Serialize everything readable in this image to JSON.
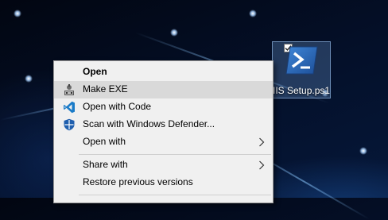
{
  "desktop": {
    "icon": {
      "label": "IIS Setup.ps1",
      "icon_name": "powershell-file-icon",
      "checked": true
    }
  },
  "context_menu": {
    "items": [
      {
        "label": "Open",
        "bold": true,
        "icon": null
      },
      {
        "label": "Make EXE",
        "icon": "make-exe-icon"
      },
      {
        "label": "Open with Code",
        "icon": "vscode-icon"
      },
      {
        "label": "Scan with Windows Defender...",
        "icon": "windows-defender-icon"
      },
      {
        "label": "Open with",
        "icon": null,
        "submenu": true
      },
      {
        "label": "Share with",
        "icon": null,
        "submenu": true
      },
      {
        "label": "Restore previous versions",
        "icon": null
      }
    ]
  },
  "colors": {
    "menu_background": "#f0f0f0",
    "menu_hover": "#d9d9d9",
    "vscode_blue": "#1a7bc8",
    "defender_blue": "#1f5fae",
    "powershell_blue": "#2b5fa8"
  }
}
